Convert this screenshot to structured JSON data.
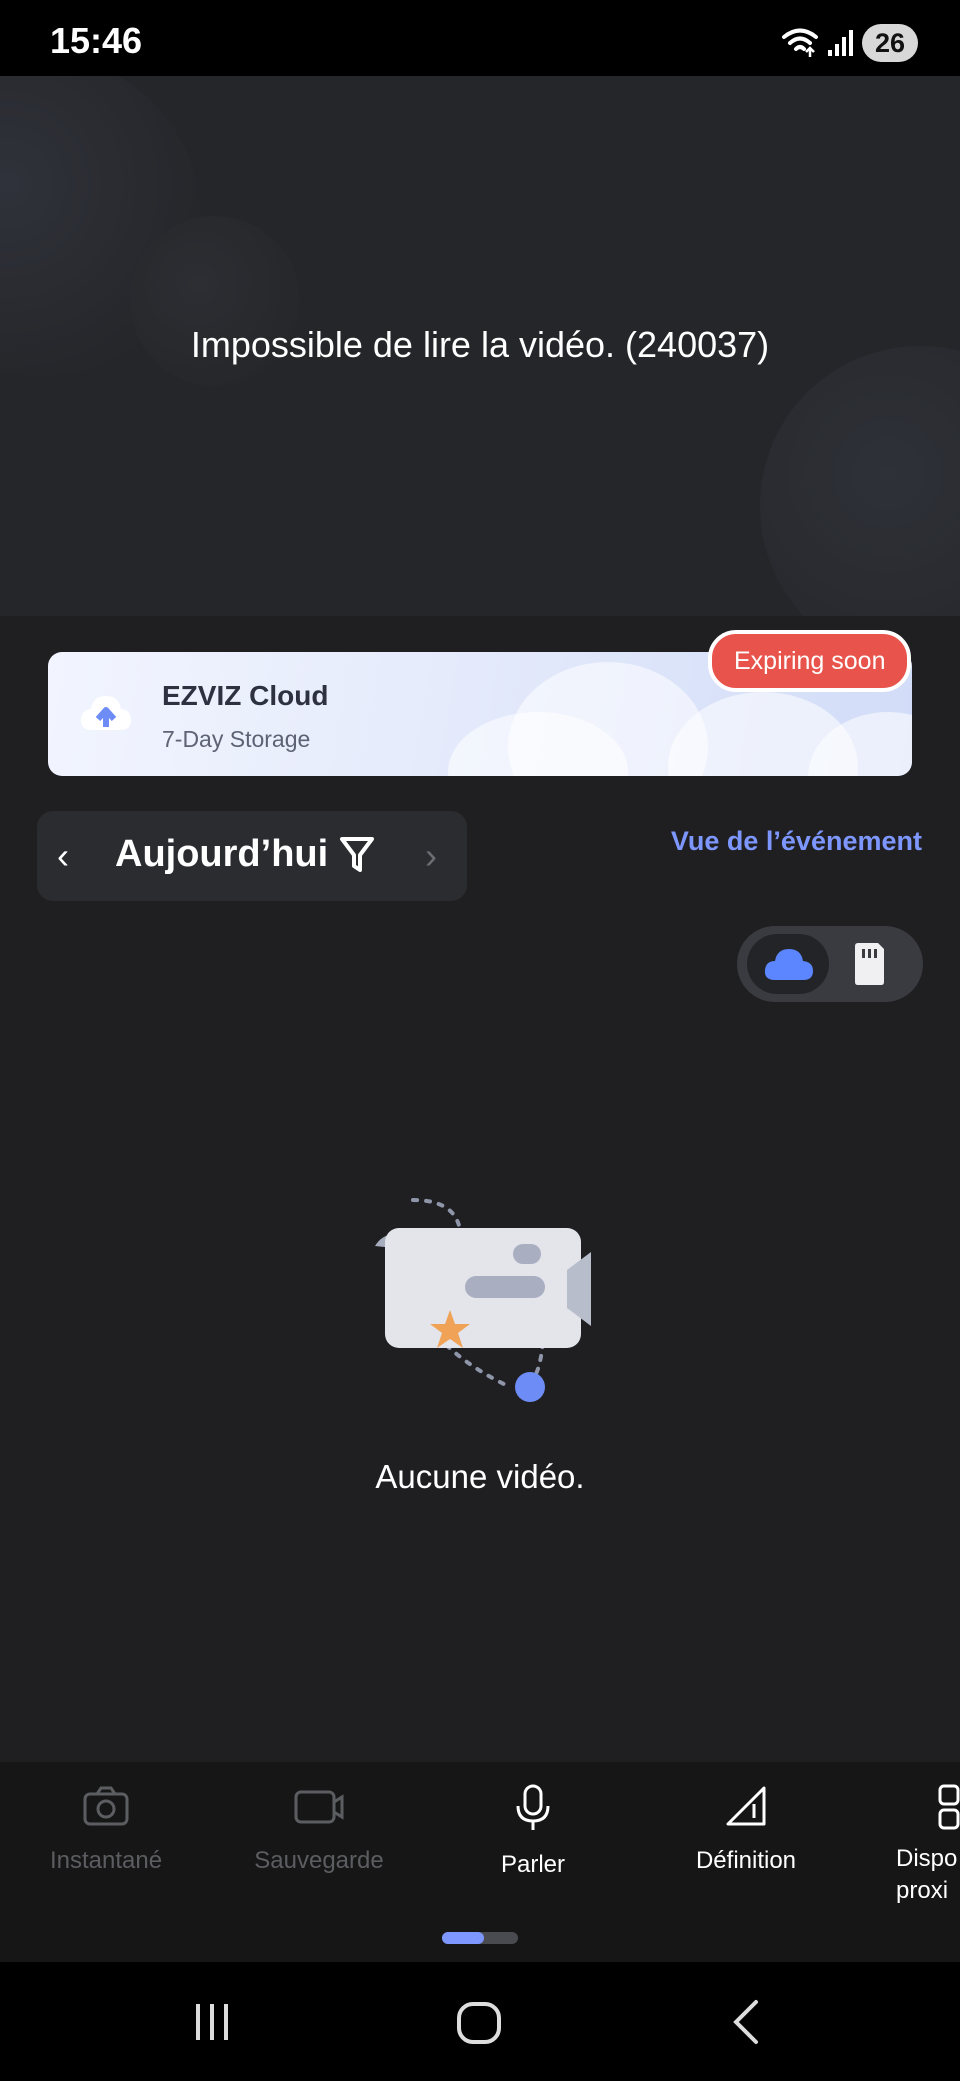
{
  "status_bar": {
    "time": "15:46",
    "battery": "26"
  },
  "player": {
    "error_message": "Impossible de lire la vidéo. (240037)"
  },
  "cloud_banner": {
    "title": "EZVIZ Cloud",
    "subtitle": "7-Day Storage",
    "badge": "Expiring soon"
  },
  "date_nav": {
    "label": "Aujourd’hui",
    "prev_glyph": "‹",
    "next_glyph": "›"
  },
  "event_view_link": "Vue de l’événement",
  "storage_toggle": {
    "selected": "cloud",
    "options": [
      "cloud-icon",
      "sd-card-icon"
    ]
  },
  "empty_state": {
    "message": "Aucune vidéo."
  },
  "toolbar": {
    "items": [
      {
        "label": "Instantané",
        "icon": "camera-icon",
        "enabled": false
      },
      {
        "label": "Sauvegarde",
        "icon": "video-record-icon",
        "enabled": false
      },
      {
        "label": "Parler",
        "icon": "microphone-icon",
        "enabled": true
      },
      {
        "label": "Définition",
        "icon": "definition-icon",
        "enabled": true
      },
      {
        "label": "Dispo proxi",
        "icon": "device-icon",
        "enabled": true
      }
    ],
    "page": 1,
    "pages": 2
  },
  "colors": {
    "accent": "#7d97ff",
    "badge": "#e8534b",
    "background": "#1f1f21"
  }
}
